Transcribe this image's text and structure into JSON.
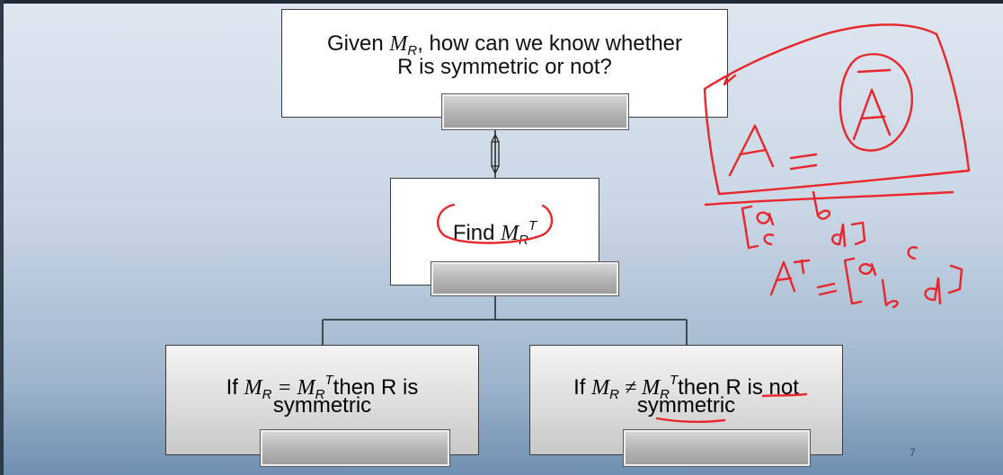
{
  "top_box": {
    "line1_pre": "Given ",
    "line1_var": "M",
    "line1_sub": "R",
    "line1_post": ", how can we know whether",
    "line2": "R is symmetric or not?"
  },
  "middle_box": {
    "word": "Find ",
    "var": "M",
    "sub": "R",
    "sup": "T"
  },
  "left_box": {
    "pre": "If ",
    "var1": "M",
    "sub1": "R",
    "op": " = ",
    "var2": "M",
    "sub2": "R",
    "sup2": "T",
    "post": "then R is",
    "line2": "symmetric"
  },
  "right_box": {
    "pre": "If ",
    "var1": "M",
    "sub1": "R",
    "op": " ≠ ",
    "var2": "M",
    "sub2": "R",
    "sup2": "T",
    "post": "then R is not",
    "line2": "symmetric"
  },
  "annotations": {
    "note_eq1": "A = Ā",
    "note_matrix": "[a b; c d]",
    "note_transpose": "Aᵀ = [a c; b d]"
  },
  "page_number": "7",
  "colors": {
    "ink_red": "#e8262b",
    "box_border": "#3b3b3b",
    "background_top": "#dfe7f0",
    "background_bottom": "#6f8fb0"
  }
}
